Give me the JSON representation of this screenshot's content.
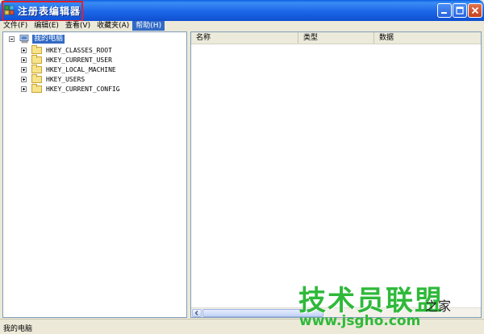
{
  "window": {
    "title": "注册表编辑器",
    "icon": "registry-editor-icon",
    "buttons": [
      "minimize-icon",
      "maximize-icon",
      "close-icon"
    ]
  },
  "menubar": {
    "items": [
      {
        "label": "文件(F)"
      },
      {
        "label": "编辑(E)"
      },
      {
        "label": "查看(V)"
      },
      {
        "label": "收藏夹(A)"
      },
      {
        "label": "帮助(H)",
        "active": true
      }
    ]
  },
  "tree": {
    "root": "我的电脑",
    "nodes": [
      "HKEY_CLASSES_ROOT",
      "HKEY_CURRENT_USER",
      "HKEY_LOCAL_MACHINE",
      "HKEY_USERS",
      "HKEY_CURRENT_CONFIG"
    ]
  },
  "list": {
    "columns": [
      "名称",
      "类型",
      "数据"
    ]
  },
  "statusbar": {
    "text": "我的电脑"
  },
  "watermark": {
    "text": "技术员联盟",
    "side": "之家",
    "url": "www.jsgho.com"
  },
  "colors": {
    "titlebar": "#0a5fe0",
    "selection": "#316ac5",
    "highlight_border": "#e0202a",
    "watermark": "#2fb93a"
  }
}
